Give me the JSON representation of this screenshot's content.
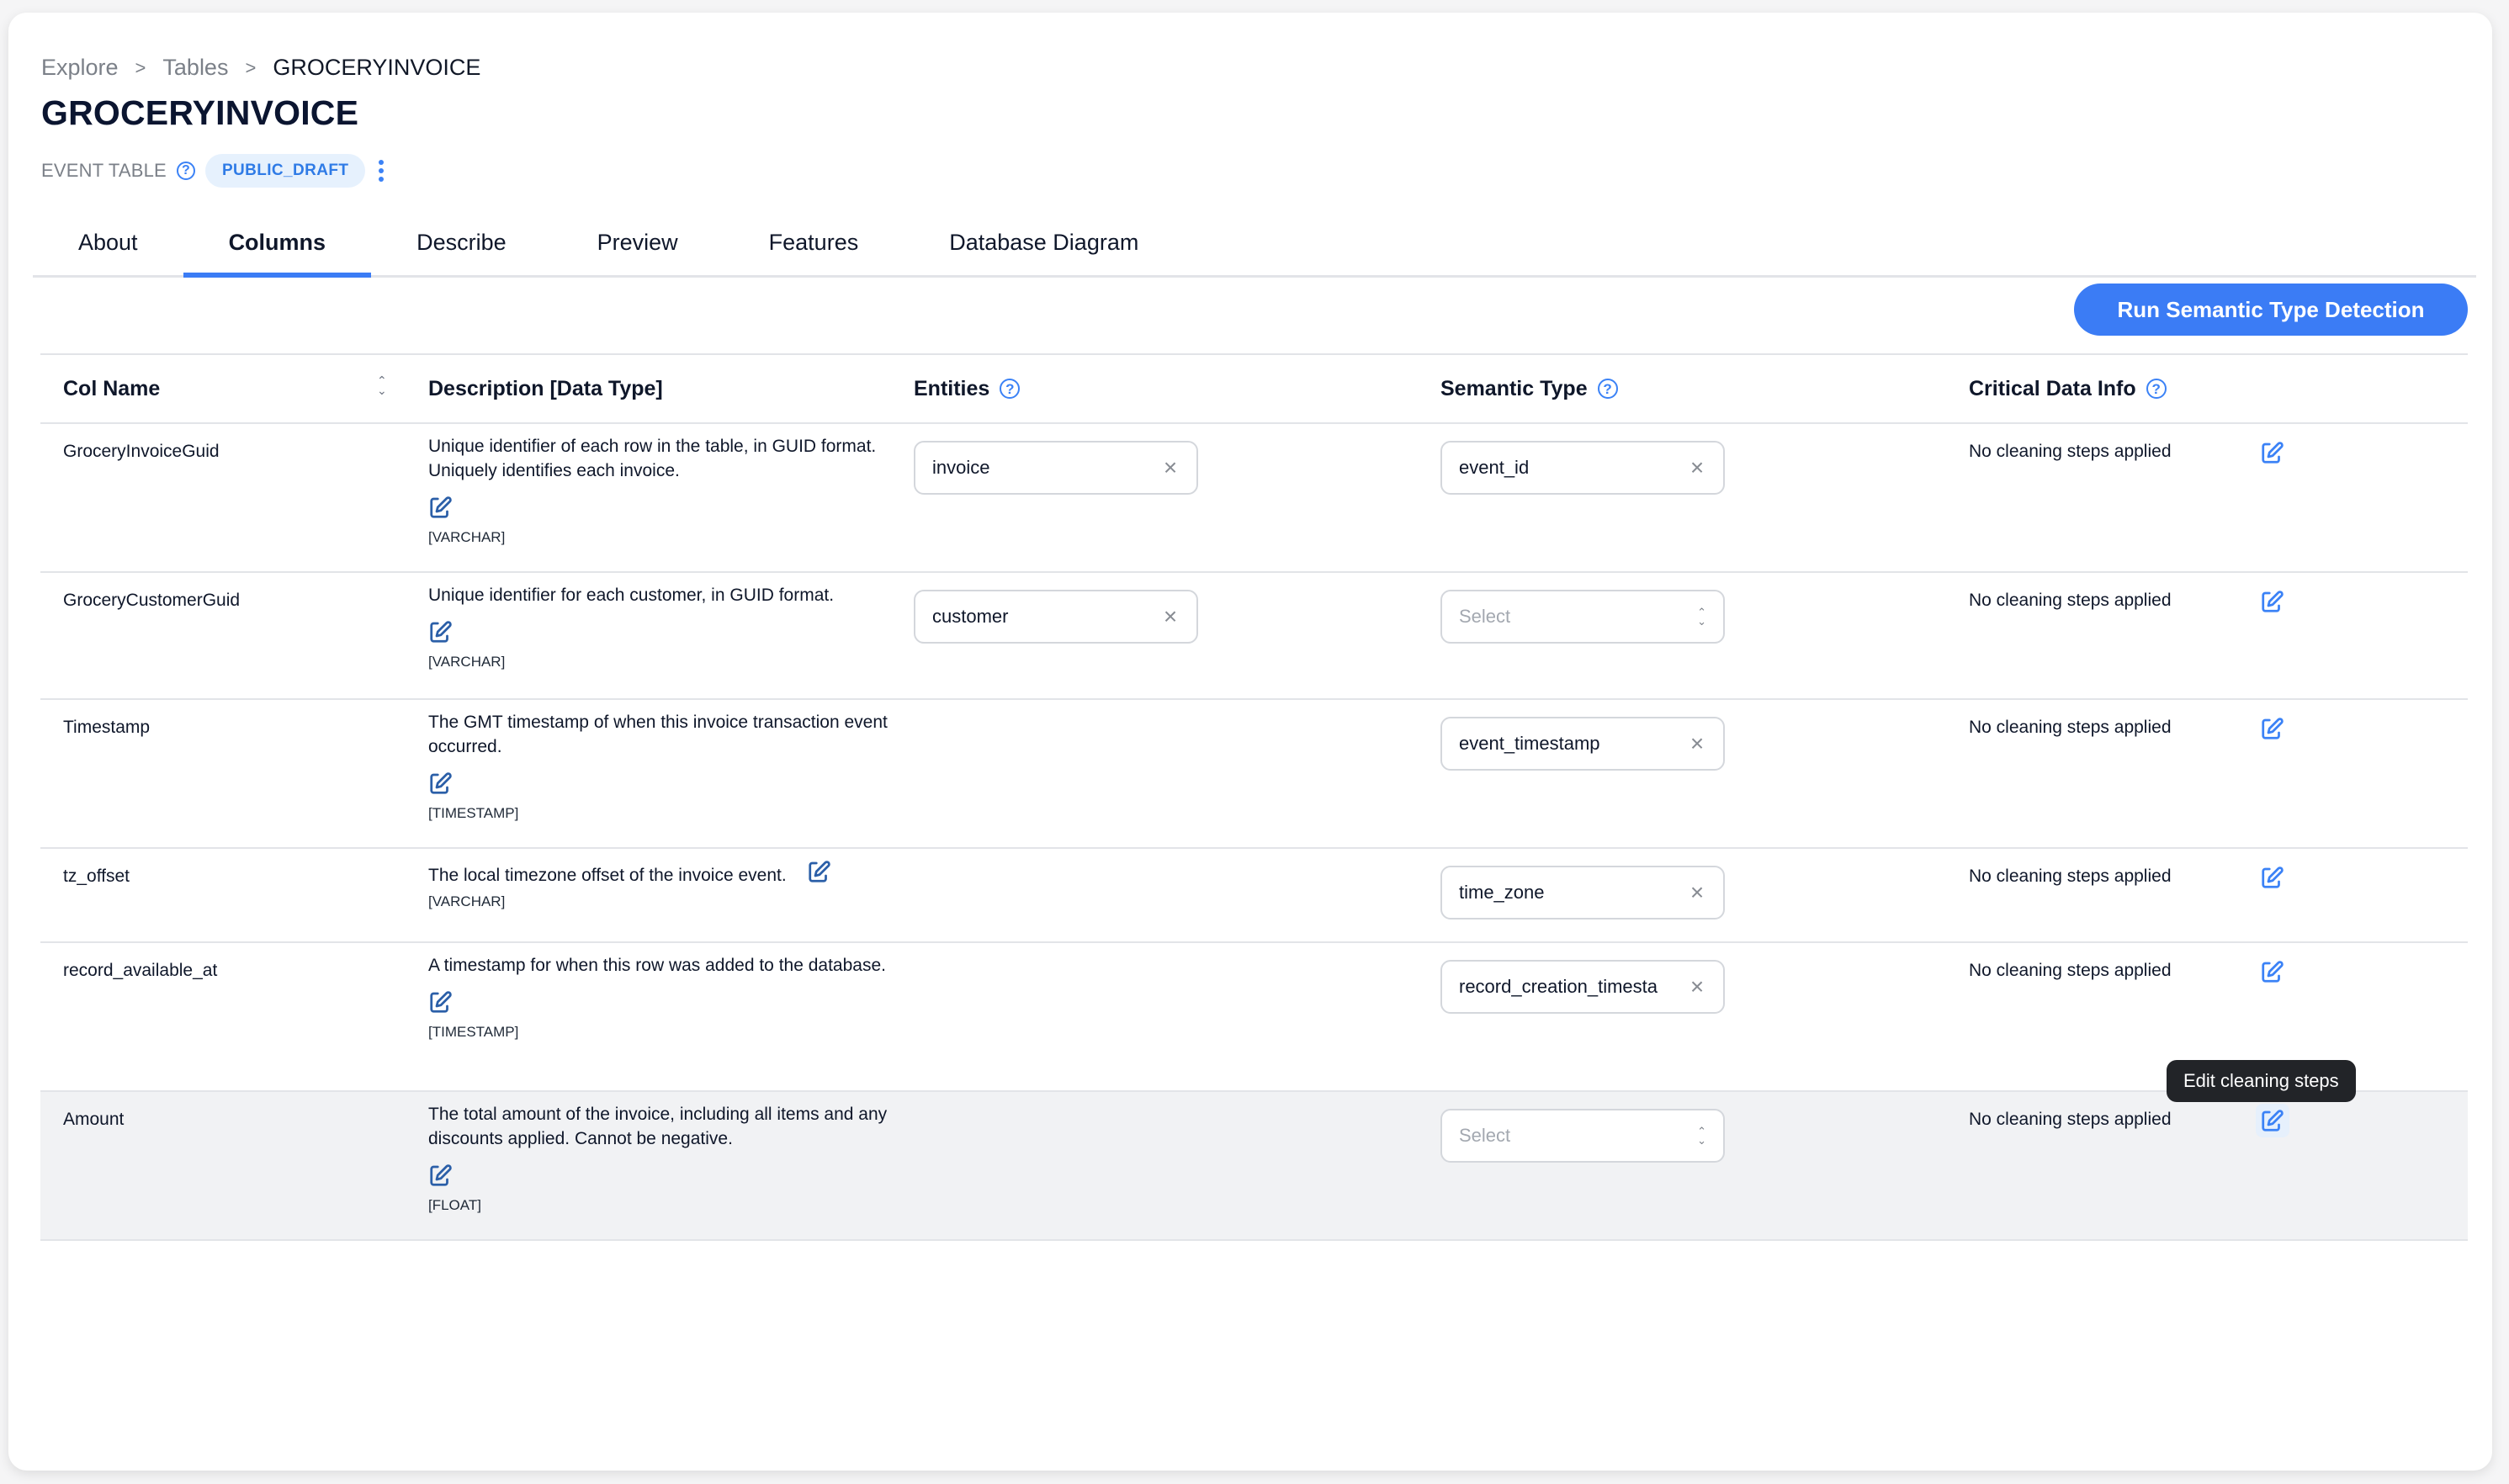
{
  "breadcrumb": [
    {
      "label": "Explore"
    },
    {
      "label": "Tables"
    },
    {
      "label": "GROCERYINVOICE"
    }
  ],
  "breadcrumb_separator": ">",
  "page_title": "GROCERYINVOICE",
  "meta": {
    "table_type": "EVENT TABLE",
    "help_icon": "question-circle-icon",
    "status_badge": "PUBLIC_DRAFT",
    "more_icon": "kebab-vertical-icon"
  },
  "tabs": [
    {
      "label": "About",
      "active": false
    },
    {
      "label": "Columns",
      "active": true
    },
    {
      "label": "Describe",
      "active": false
    },
    {
      "label": "Preview",
      "active": false
    },
    {
      "label": "Features",
      "active": false
    },
    {
      "label": "Database Diagram",
      "active": false
    }
  ],
  "actions": {
    "run_detection_label": "Run Semantic Type Detection"
  },
  "table": {
    "headers": {
      "col_name": "Col Name",
      "description": "Description [Data Type]",
      "entities": "Entities",
      "semantic_type": "Semantic Type",
      "critical_data_info": "Critical Data Info"
    },
    "select_placeholder": "Select",
    "clear_icon": "close-x-icon",
    "edit_icon": "edit-pencil-icon",
    "rows": [
      {
        "name": "GroceryInvoiceGuid",
        "description": "Unique identifier of each row in the table, in GUID format. Uniquely identifies each invoice.",
        "data_type": "[VARCHAR]",
        "entity": "invoice",
        "semantic_type": "event_id",
        "critical_info": "No cleaning steps applied"
      },
      {
        "name": "GroceryCustomerGuid",
        "description": "Unique identifier for each customer, in GUID format.",
        "data_type": "[VARCHAR]",
        "entity": "customer",
        "semantic_type": null,
        "critical_info": "No cleaning steps applied"
      },
      {
        "name": "Timestamp",
        "description": "The GMT timestamp of when this invoice transaction event occurred.",
        "data_type": "[TIMESTAMP]",
        "entity": null,
        "semantic_type": "event_timestamp",
        "critical_info": "No cleaning steps applied"
      },
      {
        "name": "tz_offset",
        "description": "The local timezone offset of the invoice event.",
        "data_type": "[VARCHAR]",
        "entity": null,
        "semantic_type": "time_zone",
        "critical_info": "No cleaning steps applied"
      },
      {
        "name": "record_available_at",
        "description": "A timestamp for when this row was added to the database.",
        "data_type": "[TIMESTAMP]",
        "entity": null,
        "semantic_type": "record_creation_timesta",
        "critical_info": "No cleaning steps applied"
      },
      {
        "name": "Amount",
        "description": "The total amount of the invoice, including all items and any discounts applied. Cannot be negative.",
        "data_type": "[FLOAT]",
        "entity": null,
        "semantic_type": null,
        "critical_info": "No cleaning steps applied"
      }
    ]
  },
  "tooltip": {
    "text": "Edit cleaning steps"
  },
  "colors": {
    "accent": "#3b7cf5",
    "badge_bg": "#e6f1fd",
    "badge_text": "#2f7be6",
    "hover_row_bg": "#f1f2f4",
    "tooltip_bg": "#222428"
  }
}
